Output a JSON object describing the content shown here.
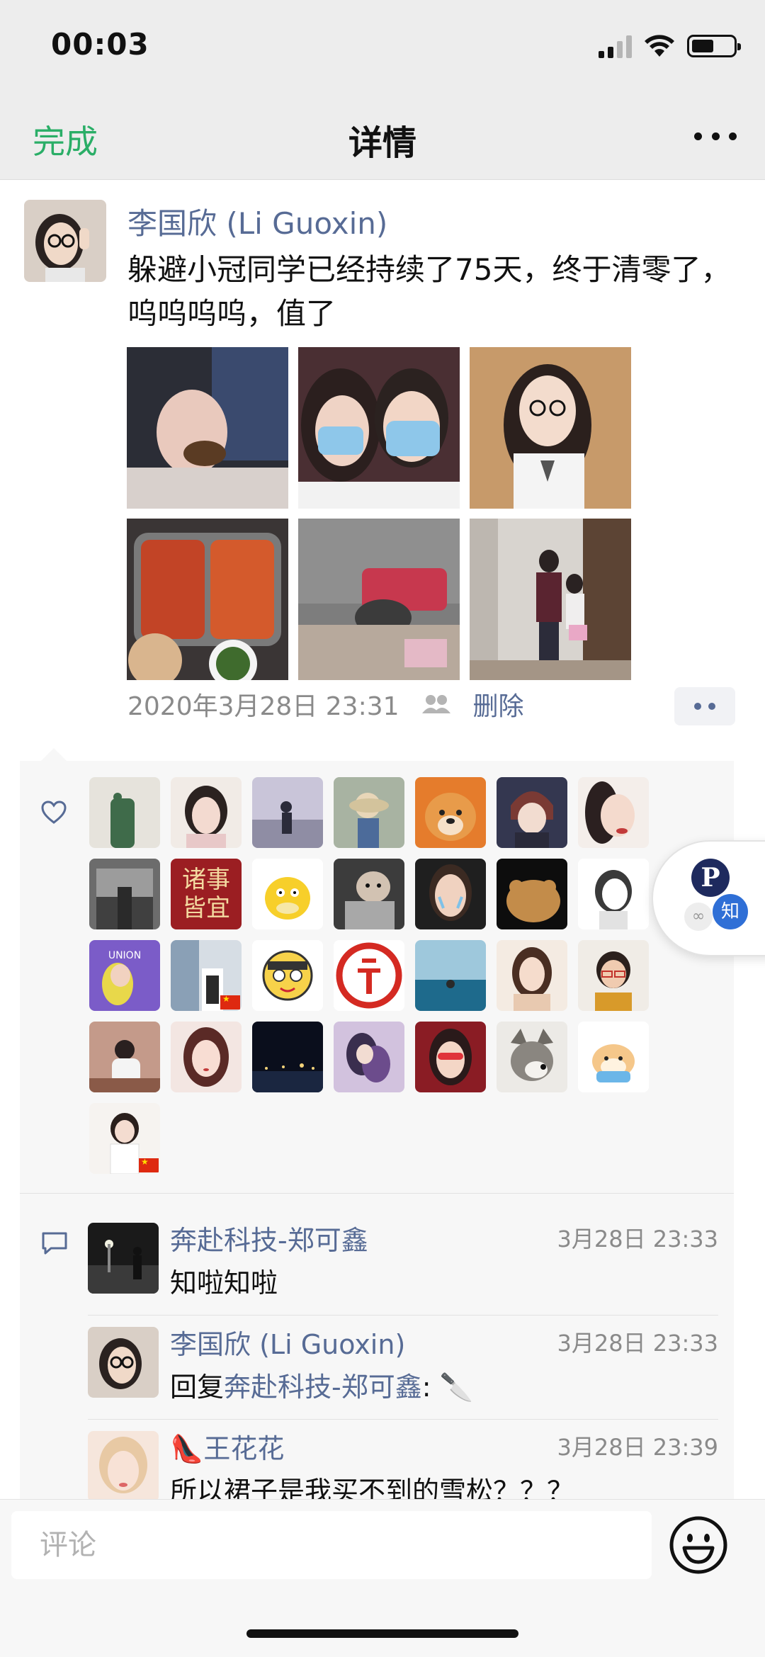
{
  "status_bar": {
    "time": "00:03"
  },
  "nav": {
    "done_label": "完成",
    "title": "详情"
  },
  "post": {
    "author": "李国欣 (Li Guoxin)",
    "text": "躲避小冠同学已经持续了75天，终于清零了，呜呜呜呜，值了",
    "photo_count": 6,
    "timestamp": "2020年3月28日 23:31",
    "delete_label": "删除"
  },
  "likes": {
    "avatar_count": 29,
    "tiles": [
      "诸事皆宜"
    ]
  },
  "comments": [
    {
      "name": "奔赴科技-郑可鑫",
      "time": "3月28日 23:33",
      "text": "知啦知啦"
    },
    {
      "name": "李国欣 (Li Guoxin)",
      "time": "3月28日 23:33",
      "reply_prefix": "回复",
      "reply_target": "奔赴科技-郑可鑫",
      "reply_suffix": ": 🔪"
    },
    {
      "name": "👠王花花",
      "time": "3月28日 23:39",
      "text": "所以裙子是我买不到的雪松？？？"
    }
  ],
  "floating_widget": {
    "badge_text": "知"
  },
  "input": {
    "placeholder": "评论"
  },
  "colors": {
    "accent_green": "#2aae67",
    "link_blue": "#576b95",
    "bg_gray": "#ededed"
  }
}
